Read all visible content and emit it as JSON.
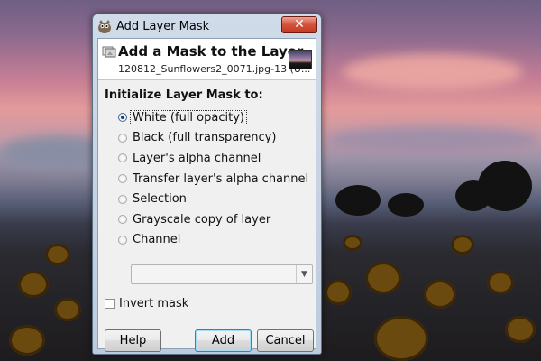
{
  "window": {
    "title": "Add Layer Mask",
    "close_glyph": "✕",
    "icon": "gimp-wilber-icon"
  },
  "header": {
    "title": "Add a Mask to the Layer",
    "subtitle": "120812_Sunflowers2_0071.jpg-13 (U..."
  },
  "section_label": "Initialize Layer Mask to:",
  "options": [
    {
      "label": "White (full opacity)",
      "checked": true
    },
    {
      "label": "Black (full transparency)",
      "checked": false
    },
    {
      "label": "Layer's alpha channel",
      "checked": false
    },
    {
      "label": "Transfer layer's alpha channel",
      "checked": false
    },
    {
      "label": "Selection",
      "checked": false
    },
    {
      "label": "Grayscale copy of layer",
      "checked": false
    },
    {
      "label": "Channel",
      "checked": false
    }
  ],
  "channel_combo": {
    "value": "",
    "arrow_glyph": "▼"
  },
  "invert_mask": {
    "label": "Invert mask",
    "checked": false
  },
  "buttons": {
    "help": "Help",
    "add": "Add",
    "cancel": "Cancel"
  },
  "colors": {
    "title_bar": "#c4d3e3",
    "close_button": "#c8432b",
    "dialog_bg": "#f0f0f0"
  }
}
